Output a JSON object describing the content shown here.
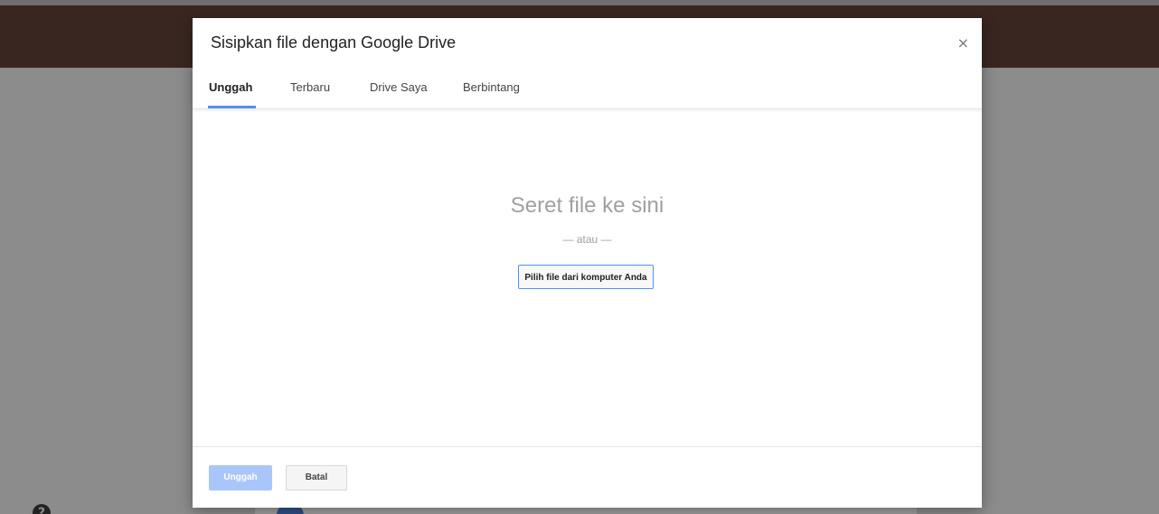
{
  "dialog": {
    "title": "Sisipkan file dengan Google Drive",
    "close_icon": "×"
  },
  "tabs": [
    {
      "label": "Unggah",
      "active": true
    },
    {
      "label": "Terbaru",
      "active": false
    },
    {
      "label": "Drive Saya",
      "active": false
    },
    {
      "label": "Berbintang",
      "active": false
    }
  ],
  "dropzone": {
    "title": "Seret file ke sini",
    "separator": "— atau —",
    "pick_button": "Pilih file dari komputer Anda"
  },
  "footer": {
    "upload_label": "Unggah",
    "cancel_label": "Batal"
  },
  "background": {
    "help_icon": "?"
  },
  "colors": {
    "accent": "#4d90fe",
    "upload_disabled": "#a9c6fb",
    "header_bg": "#3a2620"
  }
}
